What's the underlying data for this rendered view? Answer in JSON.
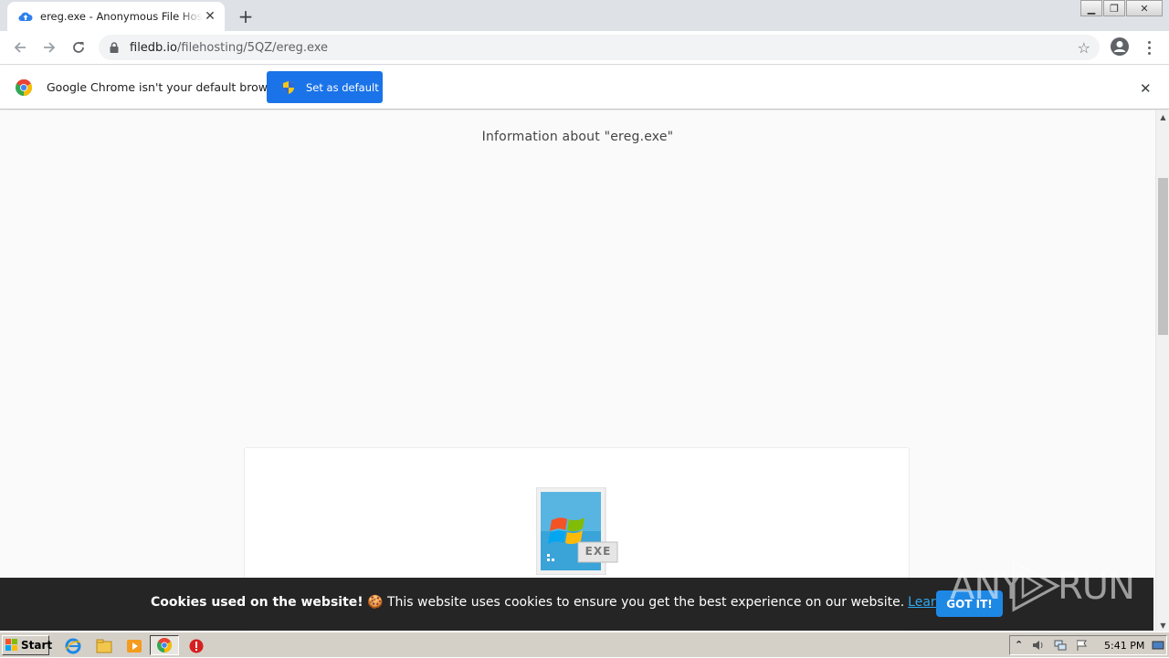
{
  "browser": {
    "tab_title": "ereg.exe - Anonymous File Hosting S",
    "new_tab_symbol": "+",
    "url_host": "filedb.io",
    "url_path": "/filehosting/5QZ/ereg.exe"
  },
  "infobar": {
    "message": "Google Chrome isn't your default browser",
    "set_default_label": "Set as default"
  },
  "page": {
    "heading": "Information about \"ereg.exe\"",
    "file_badge": "EXE"
  },
  "cookie_banner": {
    "bold_text": "Cookies used on the website!",
    "text": " 🍪 This website uses cookies to ensure you get the best experience on our website.",
    "learn_more": "Learn more",
    "button": "GOT IT!"
  },
  "watermark": {
    "left": "ANY",
    "right": "RUN"
  },
  "taskbar": {
    "start_label": "Start",
    "clock": "5:41 PM"
  },
  "colors": {
    "accent": "#1a73e8",
    "cookie_bg": "#252525",
    "cookie_link": "#31a8f0"
  }
}
